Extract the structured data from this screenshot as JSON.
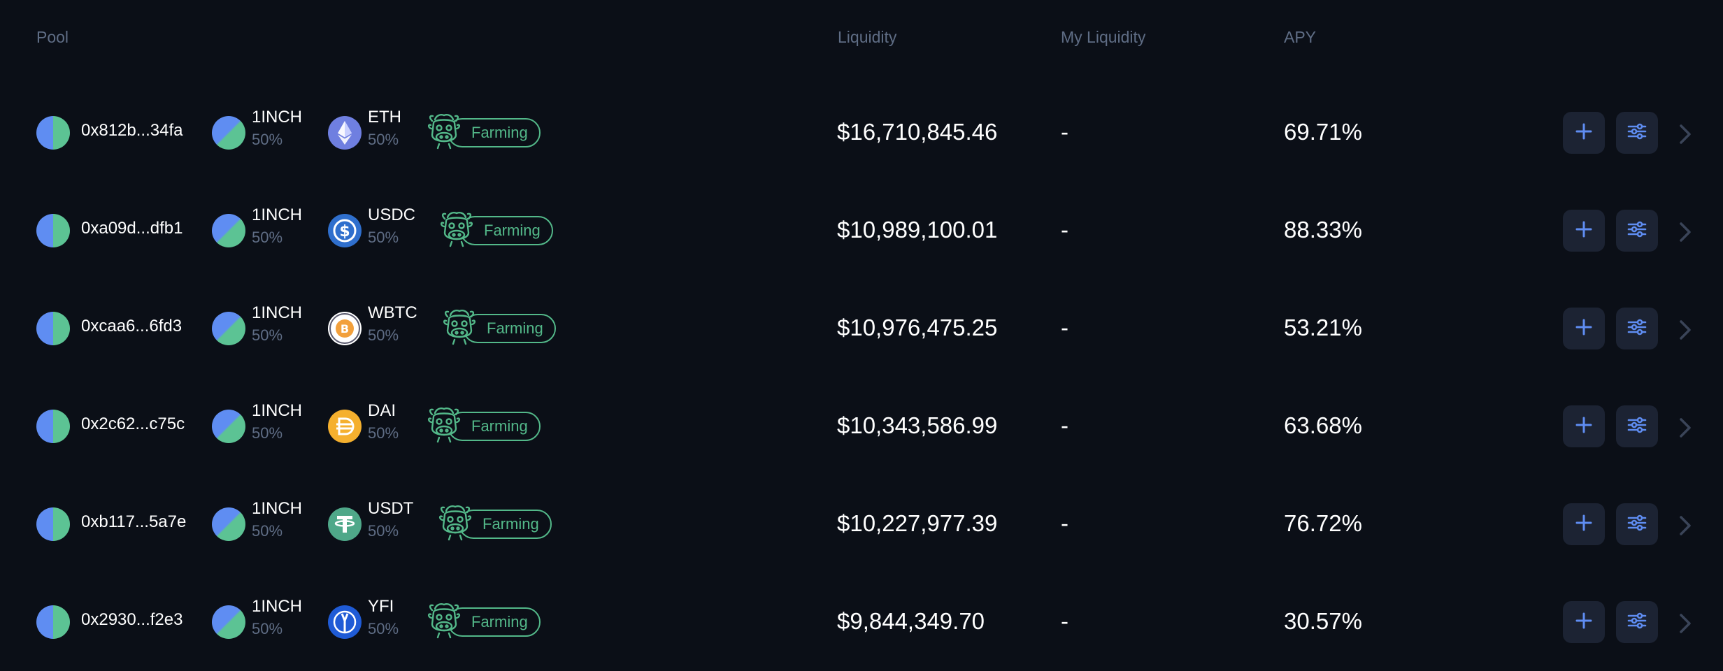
{
  "header": {
    "pool": "Pool",
    "liquidity": "Liquidity",
    "my_liquidity": "My Liquidity",
    "apy": "APY"
  },
  "colors": {
    "background": "#0b0f17",
    "muted": "#5f6d85",
    "accent_blue": "#5f8df2",
    "accent_green": "#53b889",
    "button_bg": "#1c2333"
  },
  "rows": [
    {
      "address": "0x812b...34fa",
      "token1": {
        "symbol": "1INCH",
        "share": "50%",
        "icon": "1inch-icon"
      },
      "token2": {
        "symbol": "ETH",
        "share": "50%",
        "icon": "eth-icon"
      },
      "badge": "Farming",
      "liquidity": "$16,710,845.46",
      "my_liquidity": "-",
      "apy": "69.71%"
    },
    {
      "address": "0xa09d...dfb1",
      "token1": {
        "symbol": "1INCH",
        "share": "50%",
        "icon": "1inch-icon"
      },
      "token2": {
        "symbol": "USDC",
        "share": "50%",
        "icon": "usdc-icon"
      },
      "badge": "Farming",
      "liquidity": "$10,989,100.01",
      "my_liquidity": "-",
      "apy": "88.33%"
    },
    {
      "address": "0xcaa6...6fd3",
      "token1": {
        "symbol": "1INCH",
        "share": "50%",
        "icon": "1inch-icon"
      },
      "token2": {
        "symbol": "WBTC",
        "share": "50%",
        "icon": "wbtc-icon"
      },
      "badge": "Farming",
      "liquidity": "$10,976,475.25",
      "my_liquidity": "-",
      "apy": "53.21%"
    },
    {
      "address": "0x2c62...c75c",
      "token1": {
        "symbol": "1INCH",
        "share": "50%",
        "icon": "1inch-icon"
      },
      "token2": {
        "symbol": "DAI",
        "share": "50%",
        "icon": "dai-icon"
      },
      "badge": "Farming",
      "liquidity": "$10,343,586.99",
      "my_liquidity": "-",
      "apy": "63.68%"
    },
    {
      "address": "0xb117...5a7e",
      "token1": {
        "symbol": "1INCH",
        "share": "50%",
        "icon": "1inch-icon"
      },
      "token2": {
        "symbol": "USDT",
        "share": "50%",
        "icon": "usdt-icon"
      },
      "badge": "Farming",
      "liquidity": "$10,227,977.39",
      "my_liquidity": "-",
      "apy": "76.72%"
    },
    {
      "address": "0x2930...f2e3",
      "token1": {
        "symbol": "1INCH",
        "share": "50%",
        "icon": "1inch-icon"
      },
      "token2": {
        "symbol": "YFI",
        "share": "50%",
        "icon": "yfi-icon"
      },
      "badge": "Farming",
      "liquidity": "$9,844,349.70",
      "my_liquidity": "-",
      "apy": "30.57%"
    }
  ]
}
